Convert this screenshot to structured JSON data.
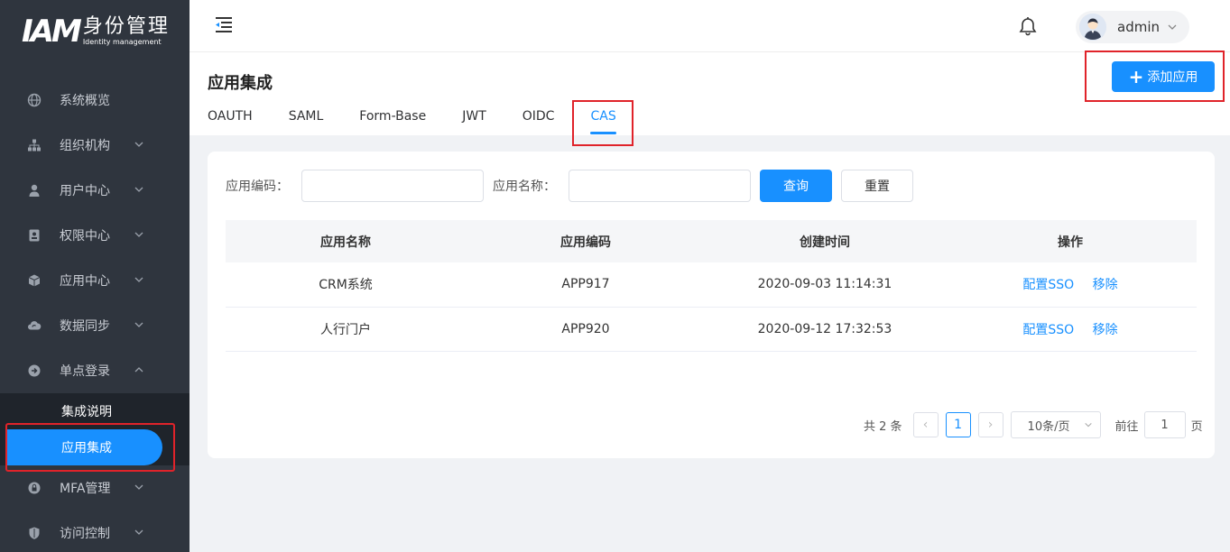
{
  "brand": {
    "mark": "IAM",
    "cn": "身份管理",
    "en": "Identity management"
  },
  "sidebar": {
    "items": [
      {
        "label": "系统概览",
        "icon": "globe-icon"
      },
      {
        "label": "组织机构",
        "icon": "org-icon"
      },
      {
        "label": "用户中心",
        "icon": "user-icon"
      },
      {
        "label": "权限中心",
        "icon": "badge-icon"
      },
      {
        "label": "应用中心",
        "icon": "cube-icon"
      },
      {
        "label": "数据同步",
        "icon": "cloud-sync-icon"
      },
      {
        "label": "单点登录",
        "icon": "login-icon"
      },
      {
        "label": "MFA管理",
        "icon": "lock-icon"
      },
      {
        "label": "访问控制",
        "icon": "shield-icon"
      }
    ],
    "submenu": {
      "integration_guide": "集成说明",
      "app_integration": "应用集成"
    }
  },
  "header": {
    "username": "admin"
  },
  "page": {
    "title": "应用集成",
    "add_button": "添加应用",
    "tabs": [
      "OAUTH",
      "SAML",
      "Form-Base",
      "JWT",
      "OIDC",
      "CAS"
    ],
    "active_tab": "CAS"
  },
  "search": {
    "code_label": "应用编码：",
    "name_label": "应用名称：",
    "query_button": "查询",
    "reset_button": "重置"
  },
  "table": {
    "headers": [
      "应用名称",
      "应用编码",
      "创建时间",
      "操作"
    ],
    "rows": [
      {
        "name": "CRM系统",
        "code": "APP917",
        "created": "2020-09-03 11:14:31",
        "config": "配置SSO",
        "remove": "移除"
      },
      {
        "name": "人行门户",
        "code": "APP920",
        "created": "2020-09-12 17:32:53",
        "config": "配置SSO",
        "remove": "移除"
      }
    ]
  },
  "pagination": {
    "total_text": "共 2 条",
    "prev": "‹",
    "current": "1",
    "next": "›",
    "page_size": "10条/页",
    "goto_label": "前往",
    "goto_value": "1",
    "page_unit": "页"
  },
  "colors": {
    "accent": "#1890ff",
    "sidebar_bg": "#2f353e",
    "highlight": "#e0232a"
  }
}
